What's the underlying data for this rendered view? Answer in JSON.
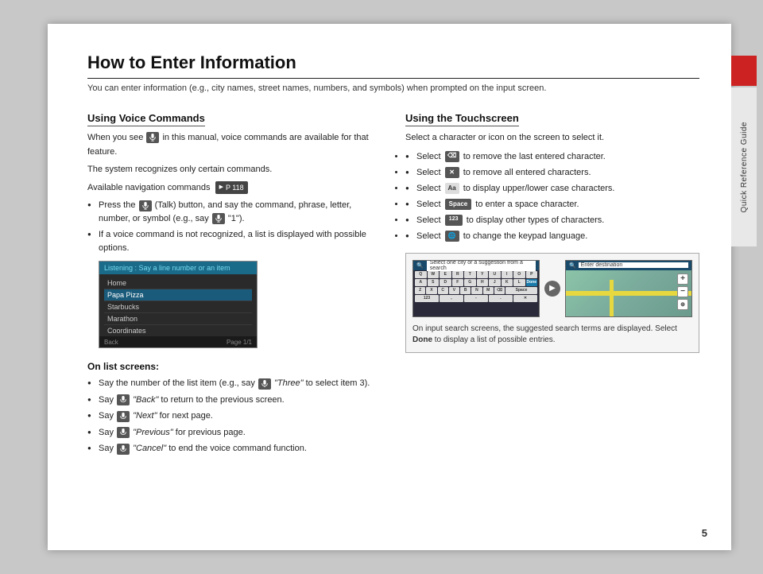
{
  "page": {
    "number": "5",
    "background": "#c8c8c8",
    "right_tab_label": "Quick Reference Guide"
  },
  "header": {
    "title": "How to Enter Information",
    "subtitle": "You can enter information (e.g., city names, street names, numbers, and symbols) when prompted on the input screen."
  },
  "voice_section": {
    "title": "Using Voice Commands",
    "para1": "in this manual, voice commands are available for that feature.",
    "para2": "The system recognizes only certain commands.",
    "para3": "Available navigation commands",
    "p_ref": "P 118",
    "bullets": [
      {
        "text1": "(Talk) button, and say the command, phrase, letter, number, or symbol (e.g., say",
        "text2": "\"1\").",
        "prefix": "Press the"
      },
      {
        "text1": "If a voice command is not recognized, a list is displayed with possible options.",
        "prefix": ""
      }
    ],
    "screenshot": {
      "header": "Listening : Say a line number or an item",
      "items": [
        "Home",
        "Papa Pizza",
        "Starbucks",
        "Marathon",
        "Coordinates"
      ],
      "footer_left": "Back",
      "footer_right": "Page 1/1"
    }
  },
  "list_screens_section": {
    "title": "On list screens:",
    "bullets": [
      {
        "text": "Say the number of the list item (e.g., say",
        "italic": "\"Three\"",
        "text2": "to select item 3)."
      },
      {
        "text": "Say",
        "italic": "\"Back\"",
        "text2": "to return to the previous screen."
      },
      {
        "text": "Say",
        "italic": "\"Next\"",
        "text2": "for next page."
      },
      {
        "text": "Say",
        "italic": "\"Previous\"",
        "text2": "for previous page."
      },
      {
        "text": "Say",
        "italic": "\"Cancel\"",
        "text2": "to end the voice command function."
      }
    ]
  },
  "touchscreen_section": {
    "title": "Using the Touchscreen",
    "intro": "Select a character or icon on the screen to select it.",
    "bullets": [
      {
        "prefix": "Select",
        "icon": "backspace",
        "text": "to remove the last entered character."
      },
      {
        "prefix": "Select",
        "icon": "x",
        "text": "to remove all entered characters."
      },
      {
        "prefix": "Select",
        "icon": "case",
        "text": "to display upper/lower case characters."
      },
      {
        "prefix": "Select",
        "bold_word": "Space",
        "text": "to enter a space character."
      },
      {
        "prefix": "Select",
        "icon": "123",
        "text": "to display other types of characters."
      },
      {
        "prefix": "Select",
        "icon": "globe",
        "text": "to change the keypad language."
      }
    ]
  },
  "image_caption": {
    "text1": "On input search screens, the suggested search terms are displayed. Select",
    "bold": "Done",
    "text2": "to display a list of possible entries."
  },
  "keyboard_rows": [
    [
      "Q",
      "W",
      "E",
      "R",
      "T",
      "Y",
      "U",
      "I",
      "O",
      "P"
    ],
    [
      "A",
      "S",
      "D",
      "F",
      "G",
      "H",
      "J",
      "K",
      "L"
    ],
    [
      "Z",
      "X",
      "C",
      "V",
      "B",
      "N",
      "M"
    ]
  ]
}
